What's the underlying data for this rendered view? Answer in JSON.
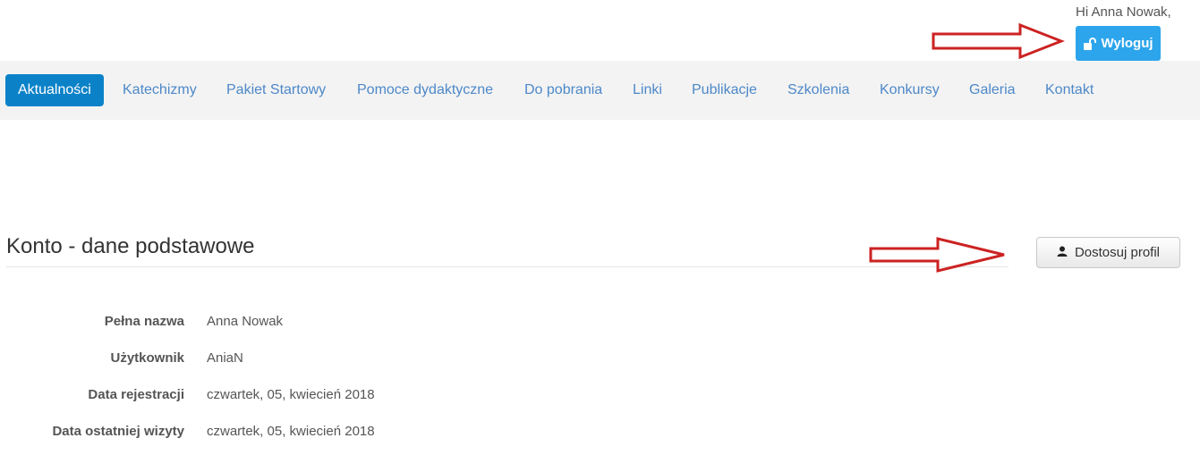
{
  "header": {
    "greeting": "Hi Anna Nowak,",
    "logout_label": "Wyloguj"
  },
  "nav": {
    "items": [
      {
        "label": "Aktualności",
        "active": true
      },
      {
        "label": "Katechizmy"
      },
      {
        "label": "Pakiet Startowy"
      },
      {
        "label": "Pomoce dydaktyczne"
      },
      {
        "label": "Do pobrania"
      },
      {
        "label": "Linki"
      },
      {
        "label": "Publikacje"
      },
      {
        "label": "Szkolenia"
      },
      {
        "label": "Konkursy"
      },
      {
        "label": "Galeria"
      },
      {
        "label": "Kontakt"
      }
    ]
  },
  "account": {
    "title": "Konto - dane podstawowe",
    "customize_label": "Dostosuj profil",
    "details": [
      {
        "label": "Pełna nazwa",
        "value": "Anna Nowak"
      },
      {
        "label": "Użytkownik",
        "value": "AniaN"
      },
      {
        "label": "Data rejestracji",
        "value": "czwartek, 05, kwiecień 2018"
      },
      {
        "label": "Data ostatniej wizyty",
        "value": "czwartek, 05, kwiecień 2018"
      }
    ]
  },
  "colors": {
    "accent": "#2da5ec",
    "nav_active": "#0b82c8",
    "nav_link": "#4d88c8",
    "annotation_arrow": "#cc2222"
  },
  "icons": {
    "logout": "unlock-icon",
    "profile": "user-icon",
    "annotations": "arrow-right-icon"
  }
}
